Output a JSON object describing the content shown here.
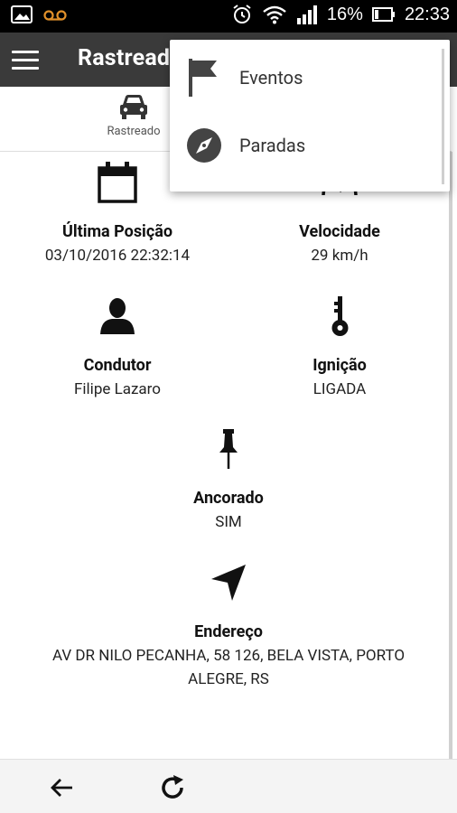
{
  "status_bar": {
    "battery_pct": "16%",
    "time": "22:33"
  },
  "app_bar": {
    "title": "Rastreado"
  },
  "tabs": [
    {
      "label": "Rastreado",
      "icon": "car-icon"
    }
  ],
  "menu": {
    "items": [
      {
        "label": "Eventos",
        "icon": "flag-icon"
      },
      {
        "label": "Paradas",
        "icon": "compass-icon"
      }
    ]
  },
  "details": {
    "last_position": {
      "label": "Última Posição",
      "value": "03/10/2016 22:32:14",
      "icon": "calendar-icon"
    },
    "speed": {
      "label": "Velocidade",
      "value": "29 km/h",
      "icon": "speedometer-icon"
    },
    "driver": {
      "label": "Condutor",
      "value": "Filipe Lazaro",
      "icon": "person-icon"
    },
    "ignition": {
      "label": "Ignição",
      "value": "LIGADA",
      "icon": "key-icon"
    },
    "anchored": {
      "label": "Ancorado",
      "value": "SIM",
      "icon": "pushpin-icon"
    },
    "address": {
      "label": "Endereço",
      "value_line1": "AV DR NILO PECANHA, 58 126, BELA VISTA, PORTO",
      "value_line2": "ALEGRE, RS",
      "icon": "navigation-arrow-icon"
    }
  },
  "bottom_bar": {
    "back_icon": "arrow-left-icon",
    "refresh_icon": "refresh-icon"
  }
}
